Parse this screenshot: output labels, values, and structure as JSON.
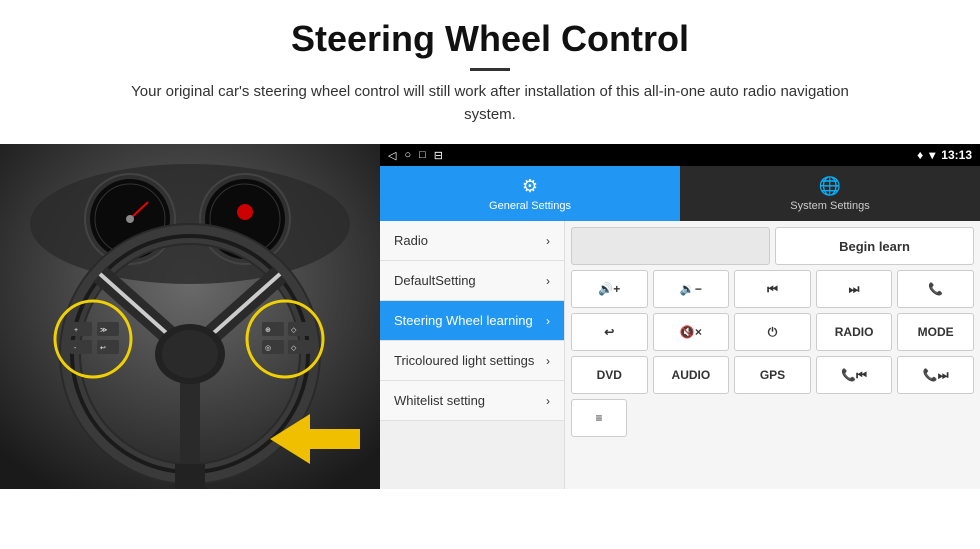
{
  "header": {
    "title": "Steering Wheel Control",
    "divider": true,
    "subtitle": "Your original car's steering wheel control will still work after installation of this all-in-one auto radio navigation system."
  },
  "status_bar": {
    "back_icon": "◁",
    "home_icon": "○",
    "square_icon": "□",
    "menu_icon": "⊟",
    "signal_icon": "▾",
    "wifi_icon": "▾",
    "time": "13:13"
  },
  "tabs": [
    {
      "id": "general",
      "icon": "⚙",
      "label": "General Settings",
      "active": true
    },
    {
      "id": "system",
      "icon": "🌐",
      "label": "System Settings",
      "active": false
    }
  ],
  "menu_items": [
    {
      "id": "radio",
      "label": "Radio",
      "active": false
    },
    {
      "id": "default-setting",
      "label": "DefaultSetting",
      "active": false
    },
    {
      "id": "steering-wheel",
      "label": "Steering Wheel learning",
      "active": true
    },
    {
      "id": "tricoloured",
      "label": "Tricoloured light settings",
      "active": false
    },
    {
      "id": "whitelist",
      "label": "Whitelist setting",
      "active": false
    }
  ],
  "controls": {
    "begin_learn_label": "Begin learn",
    "row1": [
      {
        "id": "empty",
        "label": "",
        "type": "empty"
      },
      {
        "id": "begin-learn",
        "label": "Begin learn",
        "type": "button"
      }
    ],
    "row2": [
      {
        "id": "vol-up",
        "label": "🔊+",
        "type": "icon"
      },
      {
        "id": "vol-down",
        "label": "🔉-",
        "type": "icon"
      },
      {
        "id": "prev",
        "label": "⏮",
        "type": "icon"
      },
      {
        "id": "next",
        "label": "⏭",
        "type": "icon"
      },
      {
        "id": "phone",
        "label": "📞",
        "type": "icon"
      }
    ],
    "row3": [
      {
        "id": "back",
        "label": "↩",
        "type": "icon"
      },
      {
        "id": "mute",
        "label": "🔇x",
        "type": "icon"
      },
      {
        "id": "power",
        "label": "⏻",
        "type": "icon"
      },
      {
        "id": "radio-btn",
        "label": "RADIO",
        "type": "text"
      },
      {
        "id": "mode-btn",
        "label": "MODE",
        "type": "text"
      }
    ],
    "row4": [
      {
        "id": "dvd",
        "label": "DVD",
        "type": "text"
      },
      {
        "id": "audio",
        "label": "AUDIO",
        "type": "text"
      },
      {
        "id": "gps",
        "label": "GPS",
        "type": "text"
      },
      {
        "id": "phone-prev",
        "label": "📞⏮",
        "type": "icon"
      },
      {
        "id": "phone-next",
        "label": "📞⏭",
        "type": "icon"
      }
    ],
    "row5": [
      {
        "id": "list",
        "label": "≡",
        "type": "icon"
      }
    ]
  }
}
